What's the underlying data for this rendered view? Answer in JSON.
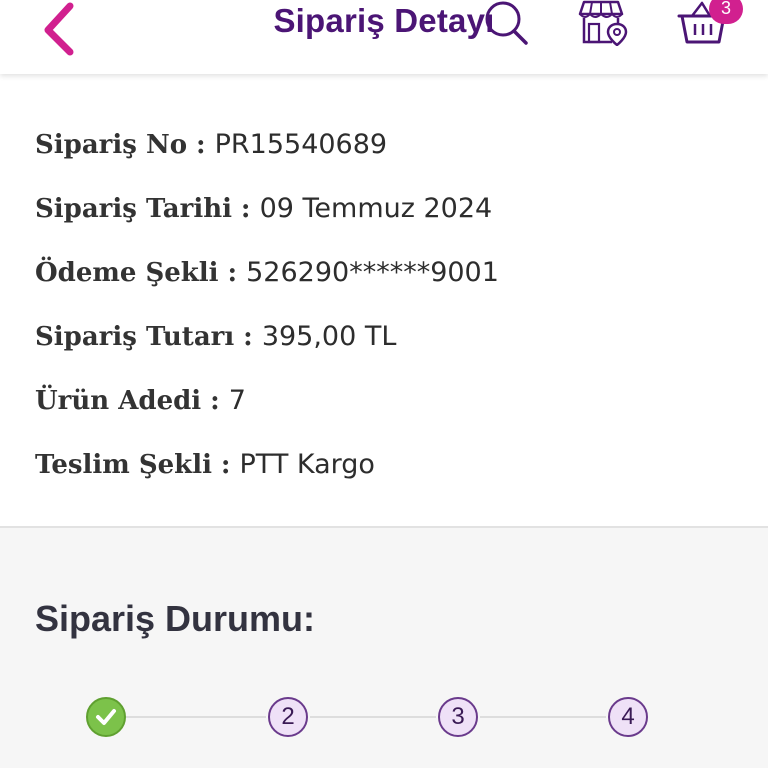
{
  "header": {
    "title": "Sipariş Detayı",
    "cart_count": "3",
    "icons": [
      "chevron-left-icon",
      "search-icon",
      "store-location-icon",
      "basket-icon"
    ],
    "accent_color": "#4b1575",
    "back_color": "#d1208f",
    "badge_color": "#d1208f"
  },
  "order": {
    "rows": [
      {
        "label": "Sipariş No",
        "separator": ":",
        "value": "PR15540689"
      },
      {
        "label": "Sipariş Tarihi",
        "separator": ":",
        "value": "09 Temmuz 2024"
      },
      {
        "label": "Ödeme Şekli",
        "separator": ":",
        "value": "526290******9001"
      },
      {
        "label": "Sipariş Tutarı",
        "separator": ":",
        "value": "395,00 TL"
      },
      {
        "label": "Ürün Adedi",
        "separator": ":",
        "value": "7"
      },
      {
        "label": "Teslim Şekli",
        "separator": ":",
        "value": "PTT Kargo"
      }
    ]
  },
  "status": {
    "title": "Sipariş Durumu:",
    "steps": [
      {
        "label": "",
        "state": "done",
        "icon": "checkmark-icon"
      },
      {
        "label": "2",
        "state": "pending"
      },
      {
        "label": "3",
        "state": "pending"
      },
      {
        "label": "4",
        "state": "pending"
      }
    ],
    "done_color": "#7cc24a",
    "pending_color": "#efe1f7"
  }
}
